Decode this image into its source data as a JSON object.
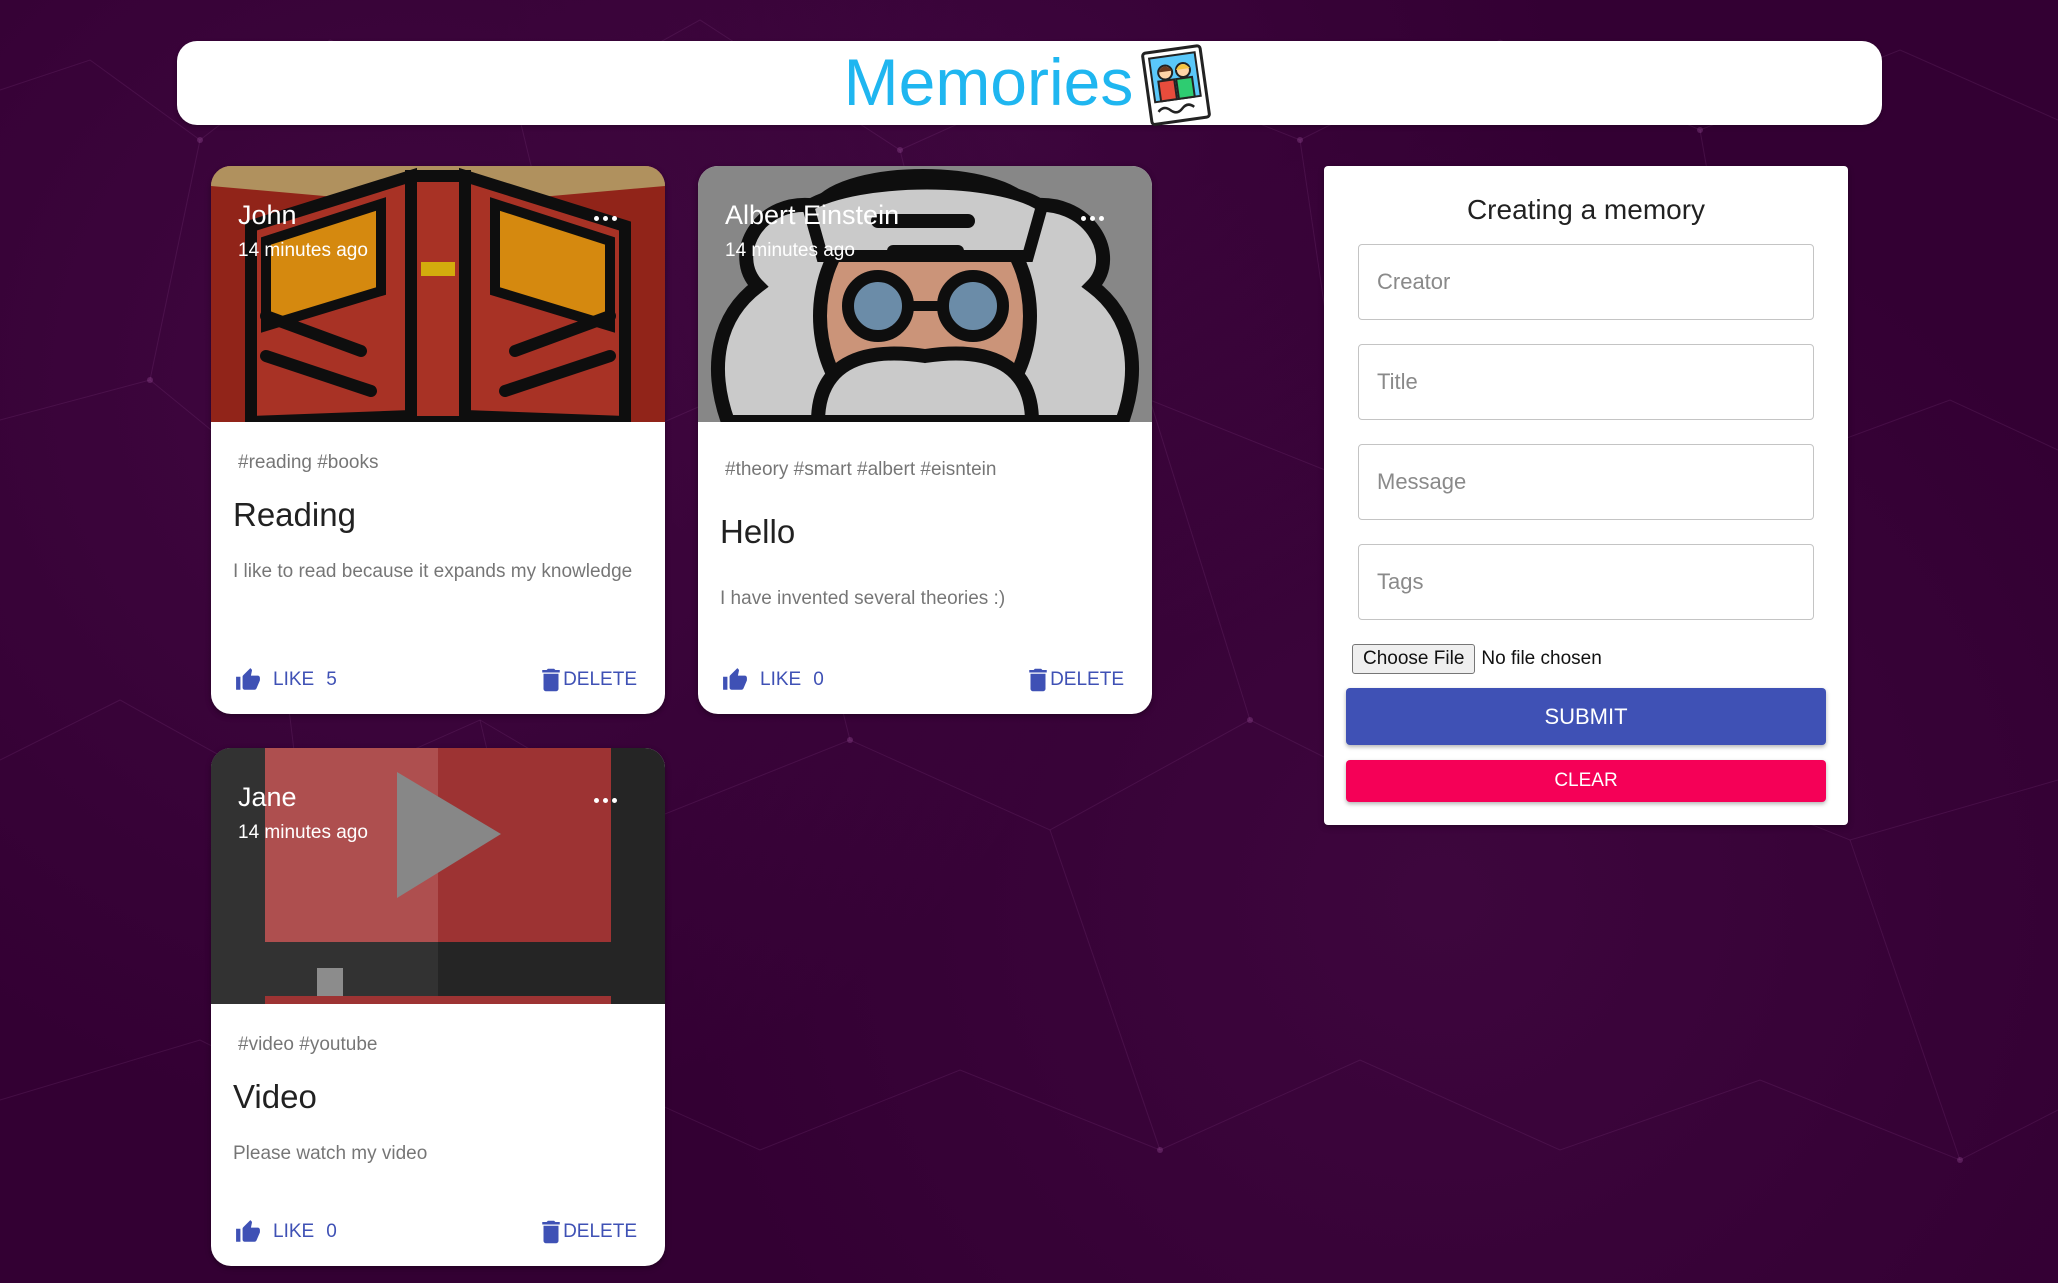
{
  "app": {
    "title": "Memories"
  },
  "posts": [
    {
      "creator": "John",
      "time": "14 minutes ago",
      "tags": "#reading #books",
      "title": "Reading",
      "message": "I like to read because it expands my knowledge",
      "like_label": "LIKE",
      "like_count": "5",
      "delete_label": "DELETE"
    },
    {
      "creator": "Albert Einstein",
      "time": "14 minutes ago",
      "tags": "#theory #smart #albert #eisntein",
      "title": "Hello",
      "message": "I have invented several theories :)",
      "like_label": "LIKE",
      "like_count": "0",
      "delete_label": "DELETE"
    },
    {
      "creator": "Jane",
      "time": "14 minutes ago",
      "tags": "#video #youtube",
      "title": "Video",
      "message": "Please watch my video",
      "like_label": "LIKE",
      "like_count": "0",
      "delete_label": "DELETE"
    }
  ],
  "form": {
    "heading": "Creating a memory",
    "creator_placeholder": "Creator",
    "title_placeholder": "Title",
    "message_placeholder": "Message",
    "tags_placeholder": "Tags",
    "file_button": "Choose File",
    "file_status": "No file chosen",
    "submit_label": "SUBMIT",
    "clear_label": "CLEAR"
  },
  "colors": {
    "background": "#330033",
    "heading": "#1fb6f0",
    "primary": "#3f51b5",
    "secondary": "#f50057"
  }
}
